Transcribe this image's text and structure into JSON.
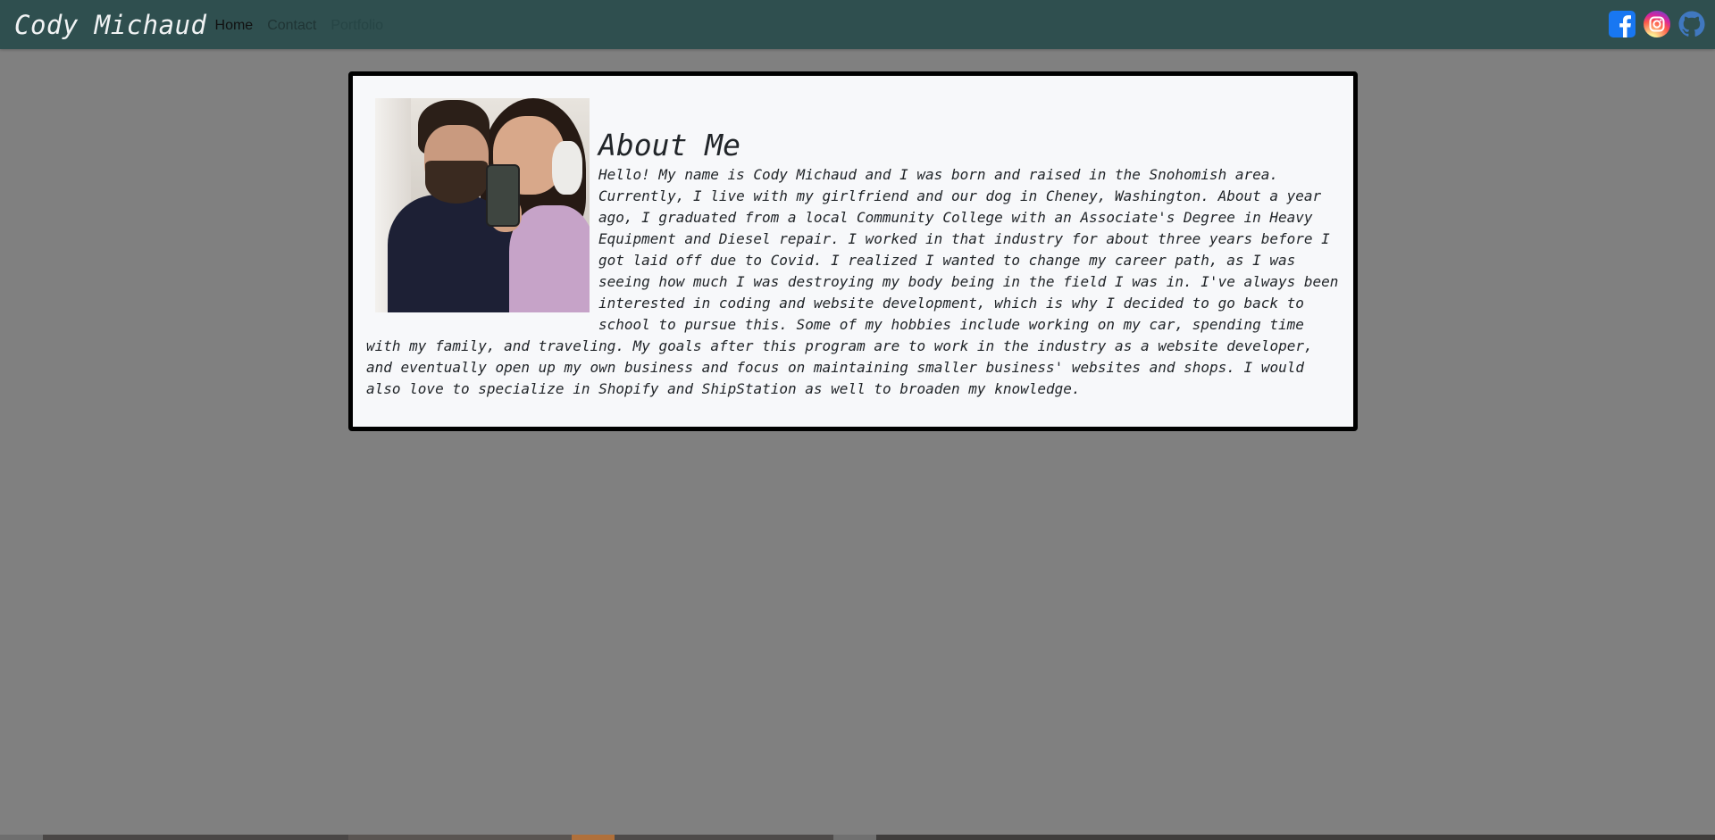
{
  "navbar": {
    "brand": "Cody Michaud",
    "links": [
      {
        "label": "Home"
      },
      {
        "label": "Contact"
      },
      {
        "label": "Portfolio"
      }
    ],
    "social": [
      {
        "icon": "facebook-icon",
        "color": "#1877f2"
      },
      {
        "icon": "instagram-icon",
        "color": "#e1306c"
      },
      {
        "icon": "github-icon",
        "color": "#4078c0"
      }
    ]
  },
  "about": {
    "title": "About Me",
    "photo_alt": "Photo of Cody and his girlfriend",
    "bio": "Hello! My name is Cody Michaud and I was born and raised in the Snohomish area. Currently, I live with my girlfriend and our dog in Cheney, Washington. About a year ago, I graduated from a local Community College with an Associate's Degree in Heavy Equipment and Diesel repair. I worked in that industry for about three years before I got laid off due to Covid. I realized I wanted to change my career path, as I was seeing how much I was destroying my body being in the field I was in. I've always been interested in coding and website development, which is why I decided to go back to school to pursue this. Some of my hobbies include working on my car, spending time with my family, and traveling. My goals after this program are to work in the industry as a website developer, and eventually open up my own business and focus on maintaining smaller business' websites and shops. I would also love to specialize in Shopify and ShipStation as well to broaden my knowledge."
  },
  "colors": {
    "navbar_bg": "#2f4f4f",
    "page_bg": "#808080",
    "card_bg": "#f7f8fa",
    "card_border": "#000000"
  }
}
